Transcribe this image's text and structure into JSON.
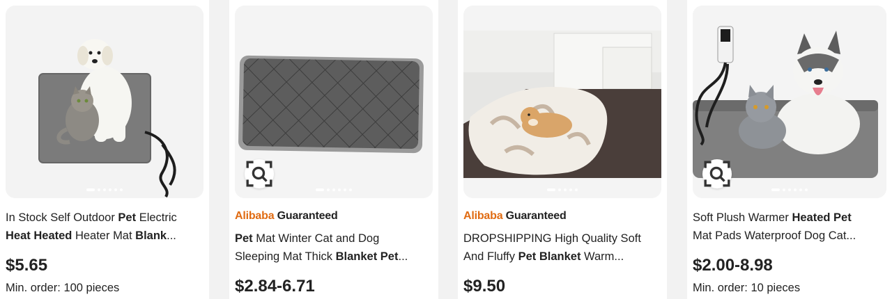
{
  "products": [
    {
      "title_line1": [
        {
          "t": "In Stock Self Outdoor ",
          "b": false
        },
        {
          "t": "Pet",
          "b": true
        },
        {
          "t": " Electric",
          "b": false
        }
      ],
      "title_line2": [
        {
          "t": "Heat Heated",
          "b": true
        },
        {
          "t": " Heater Mat ",
          "b": false
        },
        {
          "t": "Blank",
          "b": true
        },
        {
          "t": "...",
          "b": false
        }
      ],
      "price": "$5.65",
      "min_order": "Min. order: 100 pieces"
    },
    {
      "badge_brand": "Alibaba",
      "badge_word": "Guaranteed",
      "title_line1": [
        {
          "t": "Pet",
          "b": true
        },
        {
          "t": " Mat Winter Cat and Dog",
          "b": false
        }
      ],
      "title_line2": [
        {
          "t": "Sleeping Mat Thick ",
          "b": false
        },
        {
          "t": "Blanket Pet",
          "b": true
        },
        {
          "t": "...",
          "b": false
        }
      ],
      "price": "$2.84-6.71"
    },
    {
      "badge_brand": "Alibaba",
      "badge_word": "Guaranteed",
      "title_line1": [
        {
          "t": "DROPSHIPPING High Quality Soft",
          "b": false
        }
      ],
      "title_line2": [
        {
          "t": "And Fluffy ",
          "b": false
        },
        {
          "t": "Pet Blanket",
          "b": true
        },
        {
          "t": " Warm...",
          "b": false
        }
      ],
      "price": "$9.50"
    },
    {
      "title_line1": [
        {
          "t": "Soft Plush Warmer ",
          "b": false
        },
        {
          "t": "Heated Pet",
          "b": true
        }
      ],
      "title_line2": [
        {
          "t": "Mat Pads Waterproof Dog Cat...",
          "b": false
        }
      ],
      "price": "$2.00-8.98",
      "min_order": "Min. order: 10 pieces"
    }
  ],
  "icons": {
    "image_search": "image-search-icon"
  },
  "colors": {
    "brand_orange": "#e06b12",
    "text": "#222222"
  }
}
